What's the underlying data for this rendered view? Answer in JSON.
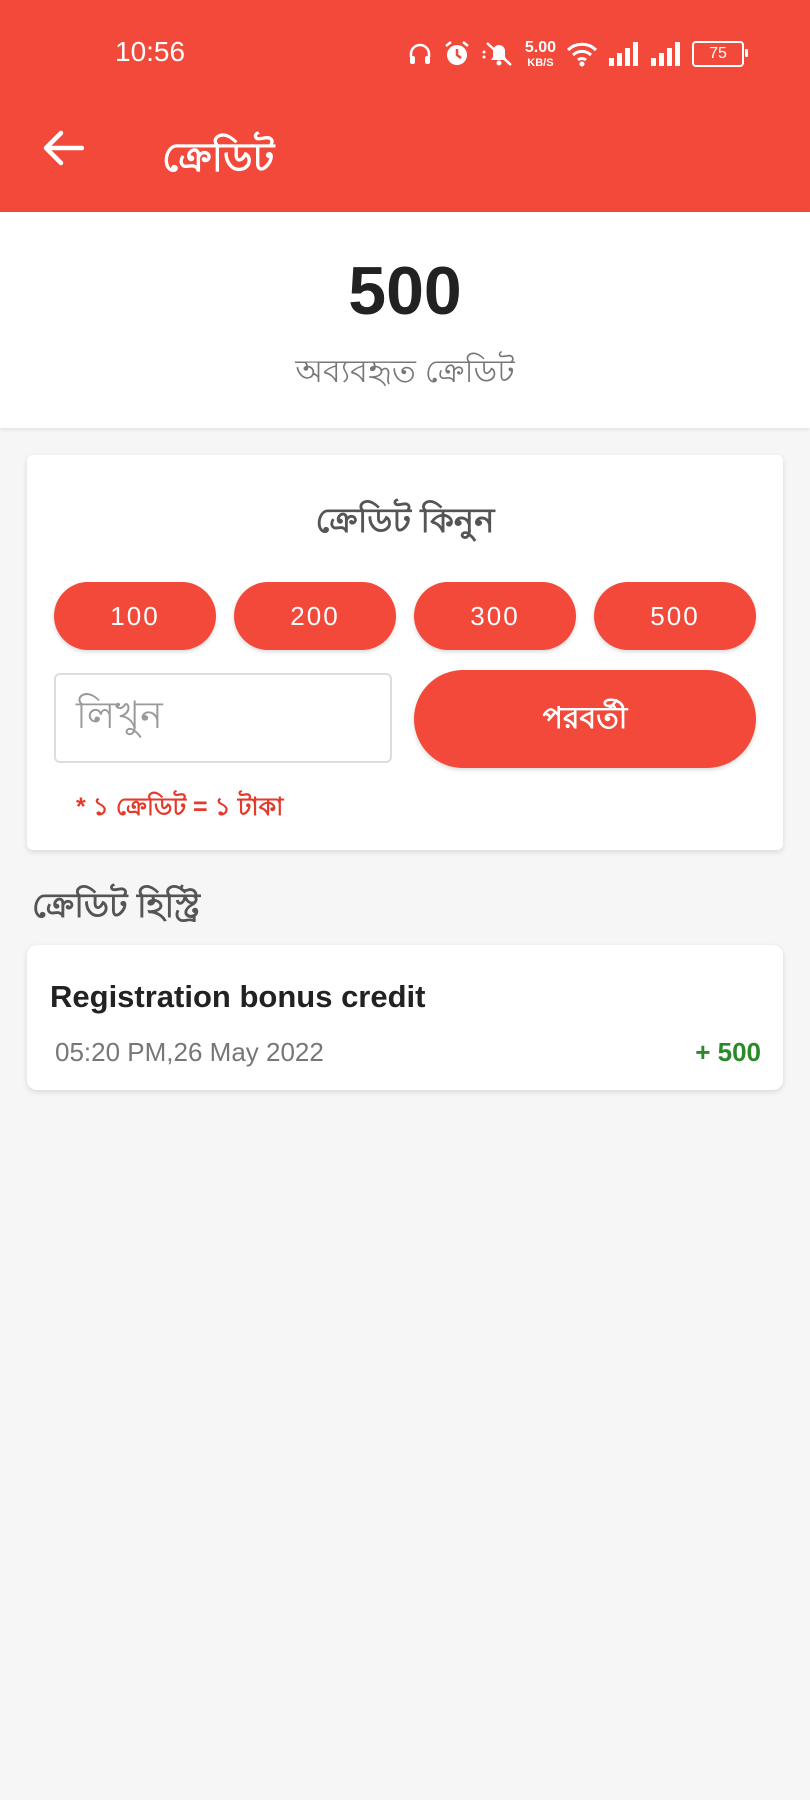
{
  "status_bar": {
    "time": "10:56",
    "speed_value": "5.00",
    "speed_unit": "KB/S",
    "battery": "75",
    "icons": [
      "headphones-icon",
      "alarm-icon",
      "bell-off-icon",
      "wifi-icon",
      "signal-icon",
      "signal-icon",
      "battery-icon"
    ]
  },
  "header": {
    "title": "ক্রেডিট",
    "back_icon": "arrow-left-icon",
    "background_color": "#f2493a"
  },
  "summary": {
    "balance": "500",
    "label": "অব্যবহৃত ক্রেডিট"
  },
  "buy": {
    "title": "ক্রেডিট কিনুন",
    "options": [
      "100",
      "200",
      "300",
      "500"
    ],
    "input_placeholder": "লিখুন",
    "next_label": "পরবর্তী",
    "rate_note": "* ১ ক্রেডিট = ১ টাকা"
  },
  "history": {
    "heading": "ক্রেডিট হিস্ট্রি",
    "items": [
      {
        "title": "Registration bonus credit",
        "date": "05:20 PM,26 May 2022",
        "amount": "+ 500"
      }
    ]
  },
  "colors": {
    "accent": "#f2493a",
    "positive": "#2a8a2a"
  }
}
